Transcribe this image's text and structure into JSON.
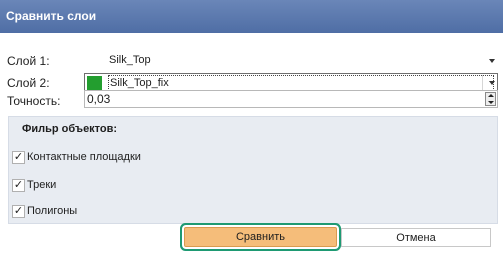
{
  "window": {
    "title": "Сравнить слои"
  },
  "layer1": {
    "label": "Слой 1:",
    "value": "Silk_Top"
  },
  "layer2": {
    "label": "Слой 2:",
    "value": "Silk_Top_fix",
    "swatch_color": "#239e2f"
  },
  "precision": {
    "label": "Точность:",
    "value": "0,03"
  },
  "filter": {
    "title": "Фильр объектов:",
    "items": [
      {
        "label": "Контактные площадки",
        "checked": true
      },
      {
        "label": "Треки",
        "checked": true
      },
      {
        "label": "Полигоны",
        "checked": true
      }
    ]
  },
  "buttons": {
    "compare": "Сравнить",
    "cancel": "Отмена"
  },
  "colors": {
    "titlebar": "#5773a9",
    "primary_button": "#f5bd7a",
    "focus_ring": "#1e9a73",
    "group_bg": "#e8ecf2"
  }
}
